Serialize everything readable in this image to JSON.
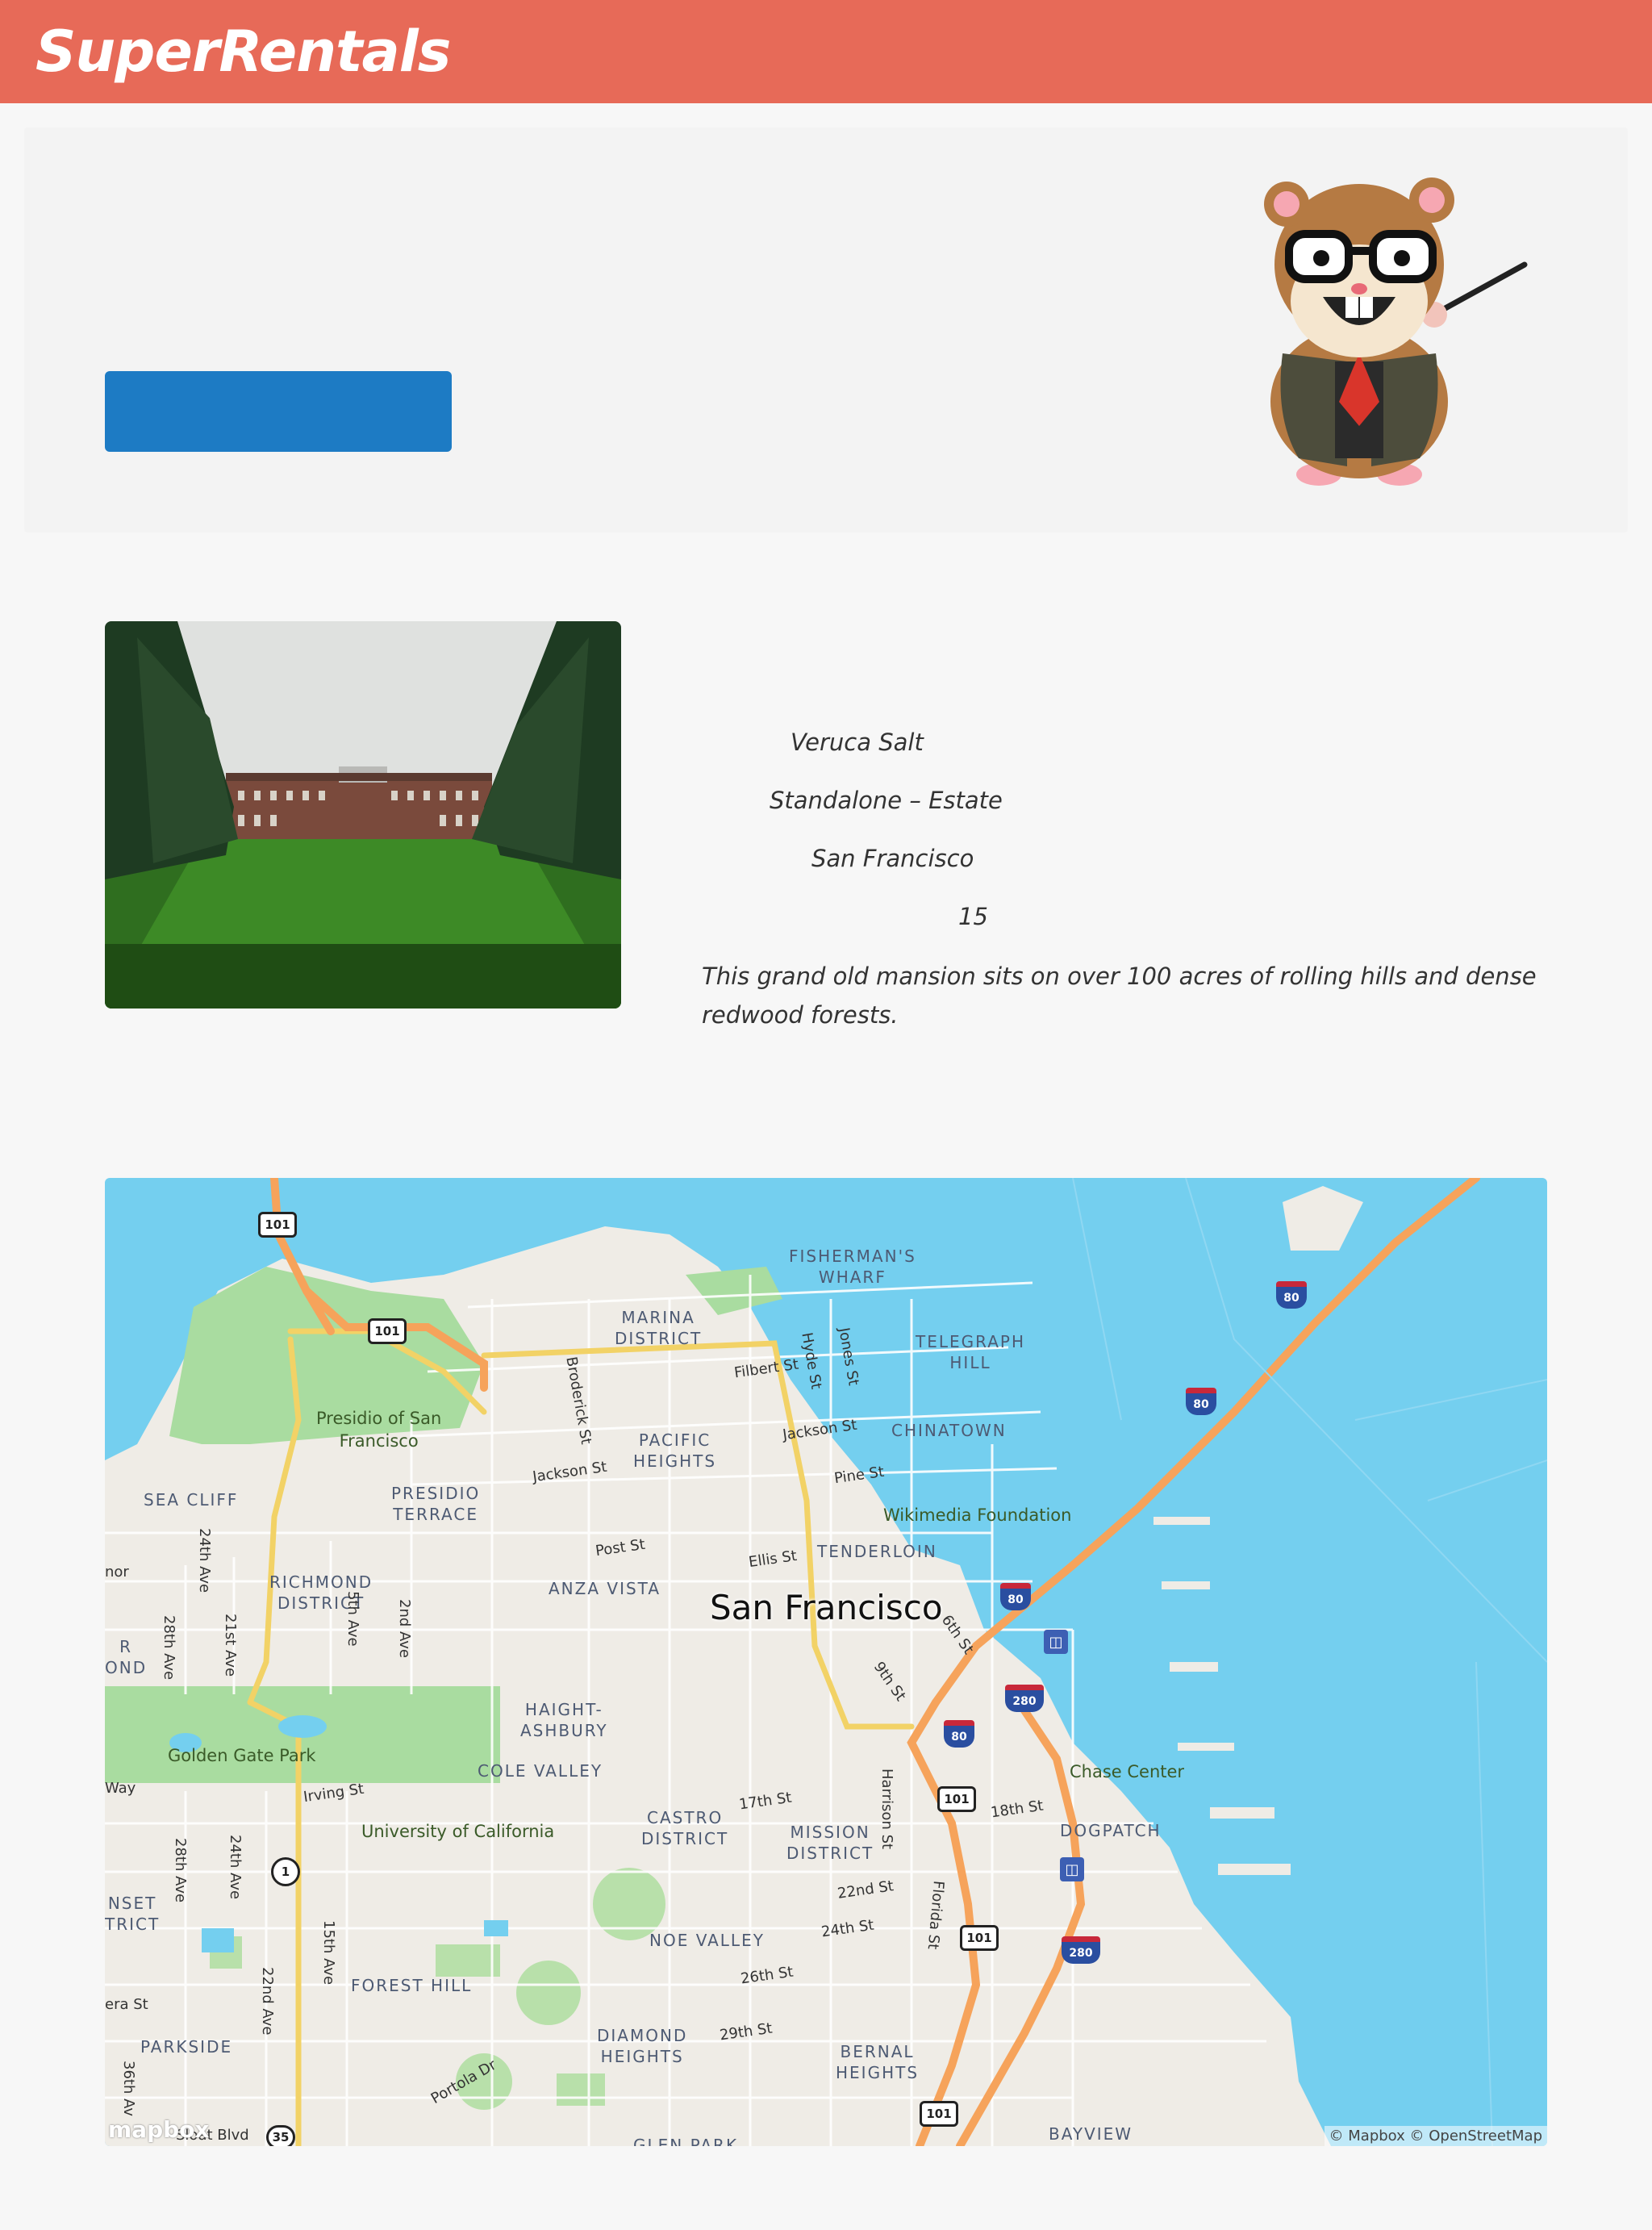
{
  "header": {
    "brand": "SuperRentals"
  },
  "jumbo": {
    "button_label": ""
  },
  "rental": {
    "owner": "Veruca Salt",
    "type": "Standalone – Estate",
    "city": "San Francisco",
    "bedrooms": "15",
    "description": "This grand old mansion sits on over 100 acres of rolling hills and dense redwood forests."
  },
  "map": {
    "city_label": "San Francisco",
    "districts": [
      "FISHERMAN'S\nWHARF",
      "MARINA\nDISTRICT",
      "TELEGRAPH\nHILL",
      "PACIFIC\nHEIGHTS",
      "CHINATOWN",
      "PRESIDIO\nTERRACE",
      "SEA CLIFF",
      "RICHMOND\nDISTRICT",
      "ANZA VISTA",
      "TENDERLOIN",
      "HAIGHT-\nASHBURY",
      "COLE VALLEY",
      "CASTRO\nDISTRICT",
      "MISSION\nDISTRICT",
      "DOGPATCH",
      "NOE VALLEY",
      "FOREST HILL",
      "DIAMOND\nHEIGHTS",
      "BERNAL\nHEIGHTS",
      "PARKSIDE",
      "BAYVIEW",
      "GLEN PARK",
      "NSET\nTRICT",
      "R\nOND"
    ],
    "pois": [
      "Presidio of San\nFrancisco",
      "Wikimedia Foundation",
      "Golden Gate Park",
      "University of California",
      "Chase Center"
    ],
    "streets": [
      "Broderick St",
      "Filbert St",
      "Hyde St",
      "Jones St",
      "Jackson St",
      "Jackson St",
      "Pine St",
      "Post St",
      "Ellis St",
      "24th Ave",
      "28th Ave",
      "21st Ave",
      "5th Ave",
      "2nd Ave",
      "6th St",
      "9th St",
      "Irving St",
      "17th St",
      "18th St",
      "Harrison St",
      "22nd St",
      "24th St",
      "Florida St",
      "26th St",
      "29th St",
      "15th Ave",
      "28th Ave",
      "24th Ave",
      "22nd Ave",
      "Portola Dr",
      "36th Av",
      "Sloat Blvd",
      "era St",
      "Way",
      "nor"
    ],
    "highway_shields": [
      "101",
      "101",
      "101",
      "101",
      "101",
      "1",
      "35"
    ],
    "interstate_shields": [
      "80",
      "80",
      "80",
      "80",
      "280",
      "280"
    ],
    "attribution": "© Mapbox © OpenStreetMap",
    "logo": "mapbox"
  },
  "colors": {
    "header": "#e76a58",
    "button": "#1d7bc4",
    "water": "#74cfef",
    "land": "#efece6",
    "park": "#a9dca0",
    "freeway": "#f6a35b",
    "arterial": "#f2d266"
  }
}
